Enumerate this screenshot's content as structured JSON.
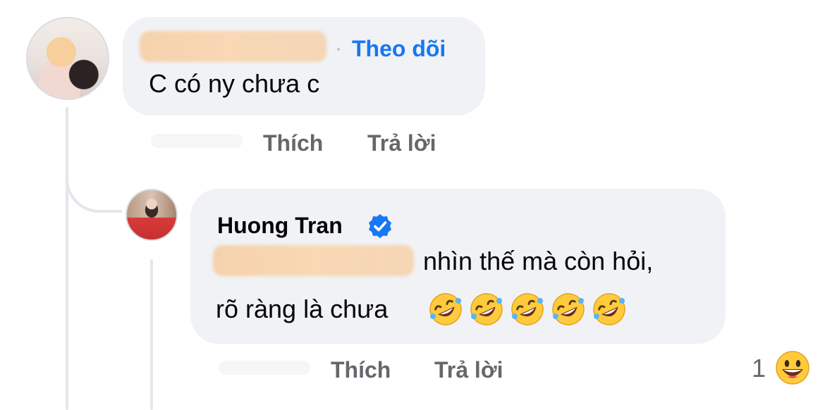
{
  "colors": {
    "bubble_background": "#f0f2f5",
    "link_blue": "#1877f2",
    "secondary_text": "#65676b",
    "primary_text": "#050505",
    "thread_line": "#e4e6eb"
  },
  "comment": {
    "follow_label": "Theo dõi",
    "follow_separator": "·",
    "text": "C có ny chưa c",
    "actions": {
      "like": "Thích",
      "reply": "Trả lời"
    }
  },
  "reply": {
    "author": "Huong Tran",
    "verified_icon": "verified-badge-icon",
    "text_line_1": "nhìn thế mà còn hỏi,",
    "text_line_2": "rõ ràng là chưa",
    "emojis": [
      "rolling-on-floor-laughing-icon",
      "rolling-on-floor-laughing-icon",
      "rolling-on-floor-laughing-icon",
      "rolling-on-floor-laughing-icon",
      "rolling-on-floor-laughing-icon"
    ],
    "actions": {
      "like": "Thích",
      "reply": "Trả lời"
    },
    "reaction": {
      "count": "1",
      "icon": "grinning-face-icon"
    }
  }
}
